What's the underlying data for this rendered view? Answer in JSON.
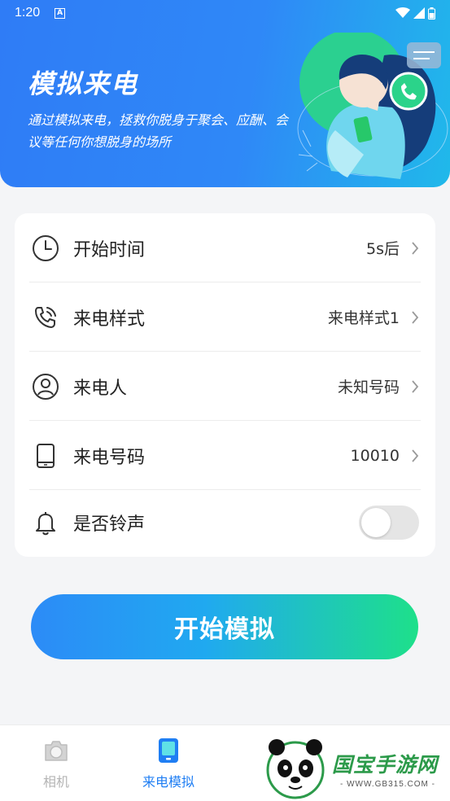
{
  "status_bar": {
    "time": "1:20",
    "notification_icon": "a-badge-icon",
    "icons": [
      "wifi-icon",
      "signal-icon",
      "battery-icon"
    ]
  },
  "header": {
    "title": "模拟来电",
    "description": "通过模拟来电，拯救你脱身于聚会、应酬、会议等任何你想脱身的场所"
  },
  "settings": {
    "rows": [
      {
        "label": "开始时间",
        "value": "5s后",
        "icon": "clock-icon"
      },
      {
        "label": "来电样式",
        "value": "来电样式1",
        "icon": "phone-ringing-icon"
      },
      {
        "label": "来电人",
        "value": "未知号码",
        "icon": "person-icon"
      },
      {
        "label": "来电号码",
        "value": "10010",
        "icon": "tablet-icon"
      },
      {
        "label": "是否铃声",
        "icon": "bell-icon",
        "toggle_on": false
      }
    ]
  },
  "start_button": {
    "label": "开始模拟"
  },
  "bottom_nav": {
    "items": [
      {
        "label": "相机",
        "icon": "camera-icon",
        "active": false
      },
      {
        "label": "来电模拟",
        "icon": "phone-screen-icon",
        "active": true
      }
    ]
  },
  "watermark": {
    "name": "国宝手游网",
    "url": "- WWW.GB315.COM -"
  },
  "colors": {
    "accent": "#1f7ef3",
    "header_start": "#2f7cf6",
    "header_end": "#20b9ea",
    "button_end": "#1ee08a",
    "background": "#f4f5f7"
  }
}
